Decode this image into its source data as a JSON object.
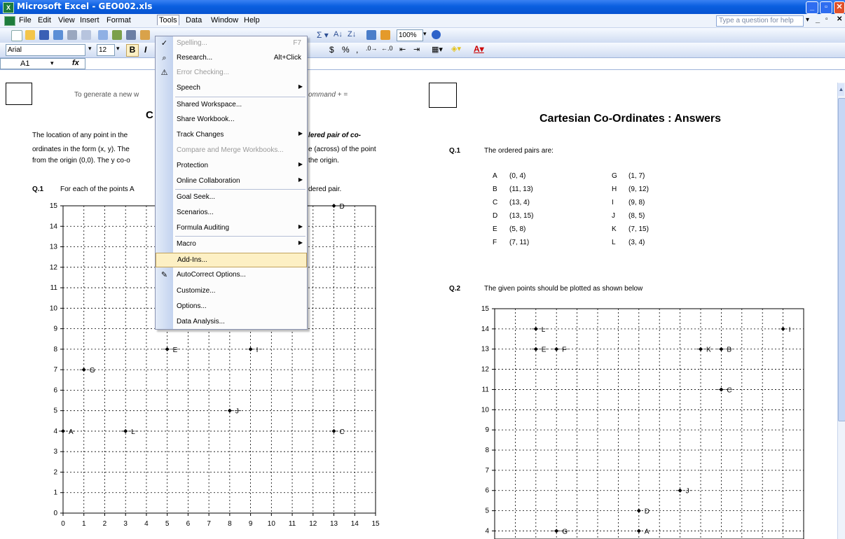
{
  "window": {
    "title": "Microsoft Excel - GEO002.xls",
    "app_icon": "X"
  },
  "menubar": {
    "items": [
      "File",
      "Edit",
      "View",
      "Insert",
      "Format",
      "Tools",
      "Data",
      "Window",
      "Help"
    ],
    "help_placeholder": "Type a question for help"
  },
  "toolbar": {
    "font": "Arial",
    "size": "12",
    "zoom": "100%",
    "bold": "B",
    "italic": "I"
  },
  "formula_bar": {
    "cell": "A1",
    "fx": "fx"
  },
  "tools_menu": {
    "items": [
      {
        "label": "Spelling...",
        "shortcut": "F7",
        "disabled": true
      },
      {
        "label": "Research...",
        "shortcut": "Alt+Click"
      },
      {
        "label": "Error Checking...",
        "disabled": true
      },
      {
        "label": "Speech",
        "submenu": true
      },
      {
        "label": "Shared Workspace..."
      },
      {
        "label": "Share Workbook..."
      },
      {
        "label": "Track Changes",
        "submenu": true
      },
      {
        "label": "Compare and Merge Workbooks...",
        "disabled": true
      },
      {
        "label": "Protection",
        "submenu": true
      },
      {
        "label": "Online Collaboration",
        "submenu": true
      },
      {
        "label": "Goal Seek..."
      },
      {
        "label": "Scenarios..."
      },
      {
        "label": "Formula Auditing",
        "submenu": true
      },
      {
        "label": "Macro",
        "submenu": true
      },
      {
        "label": "Add-Ins...",
        "highlighted": true
      },
      {
        "label": "AutoCorrect Options..."
      },
      {
        "label": "Customize..."
      },
      {
        "label": "Options..."
      },
      {
        "label": "Data Analysis..."
      }
    ]
  },
  "left_sheet": {
    "instruction_left": "To generate a new w",
    "instruction_right": "ommand + =",
    "title_fragment": "C",
    "para_line1_left": "The location of any point in the",
    "para_line1_right": "lered pair of co-",
    "para_line2_left": "ordinates in the form (x, y).  The",
    "para_line2_right": "e (across) of the point",
    "para_line3_left": "from the origin (0,0).  The y co-o",
    "para_line3_right": "the origin.",
    "q1_label": "Q.1",
    "q1_left": "For each of the points A",
    "q1_right": "dered pair."
  },
  "right_sheet": {
    "title": "Cartesian Co-Ordinates : Answers",
    "q1_label": "Q.1",
    "q1_text": "The ordered pairs are:",
    "pairs": [
      {
        "k": "A",
        "v": "(0, 4)"
      },
      {
        "k": "B",
        "v": "(11, 13)"
      },
      {
        "k": "C",
        "v": "(13, 4)"
      },
      {
        "k": "D",
        "v": "(13, 15)"
      },
      {
        "k": "E",
        "v": "(5, 8)"
      },
      {
        "k": "F",
        "v": "(7, 11)"
      },
      {
        "k": "G",
        "v": "(1, 7)"
      },
      {
        "k": "H",
        "v": "(9, 12)"
      },
      {
        "k": "I",
        "v": "(9, 8)"
      },
      {
        "k": "J",
        "v": "(8, 5)"
      },
      {
        "k": "K",
        "v": "(7, 15)"
      },
      {
        "k": "L",
        "v": "(3, 4)"
      }
    ],
    "q2_label": "Q.2",
    "q2_text": "The given points should be plotted as shown below"
  },
  "chart_data": [
    {
      "type": "scatter",
      "x_ticks": [
        0,
        1,
        2,
        3,
        4,
        5,
        6,
        7,
        8,
        9,
        10,
        11,
        12,
        13,
        14,
        15
      ],
      "y_ticks": [
        0,
        1,
        2,
        3,
        4,
        5,
        6,
        7,
        8,
        9,
        10,
        11,
        12,
        13,
        14,
        15
      ],
      "xlim": [
        0,
        15
      ],
      "ylim": [
        0,
        15
      ],
      "grid": true,
      "points": [
        {
          "label": "A",
          "x": 0,
          "y": 4
        },
        {
          "label": "L",
          "x": 3,
          "y": 4
        },
        {
          "label": "C",
          "x": 13,
          "y": 4
        },
        {
          "label": "J",
          "x": 8,
          "y": 5
        },
        {
          "label": "G",
          "x": 1,
          "y": 7
        },
        {
          "label": "E",
          "x": 5,
          "y": 8
        },
        {
          "label": "I",
          "x": 9,
          "y": 8
        },
        {
          "label": "D",
          "x": 13,
          "y": 15
        }
      ]
    },
    {
      "type": "scatter",
      "y_ticks": [
        4,
        5,
        6,
        7,
        8,
        9,
        10,
        11,
        12,
        13,
        14,
        15
      ],
      "xlim": [
        0,
        15
      ],
      "ylim": [
        3.6,
        15
      ],
      "grid": true,
      "points": [
        {
          "label": "L",
          "x": 2,
          "y": 14
        },
        {
          "label": "I",
          "x": 14,
          "y": 14
        },
        {
          "label": "E",
          "x": 2,
          "y": 13
        },
        {
          "label": "F",
          "x": 3,
          "y": 13
        },
        {
          "label": "K",
          "x": 10,
          "y": 13
        },
        {
          "label": "B",
          "x": 11,
          "y": 13
        },
        {
          "label": "C",
          "x": 11,
          "y": 11
        },
        {
          "label": "J",
          "x": 9,
          "y": 6
        },
        {
          "label": "D",
          "x": 7,
          "y": 5
        },
        {
          "label": "G",
          "x": 3,
          "y": 4
        },
        {
          "label": "A",
          "x": 7,
          "y": 4
        }
      ]
    }
  ]
}
